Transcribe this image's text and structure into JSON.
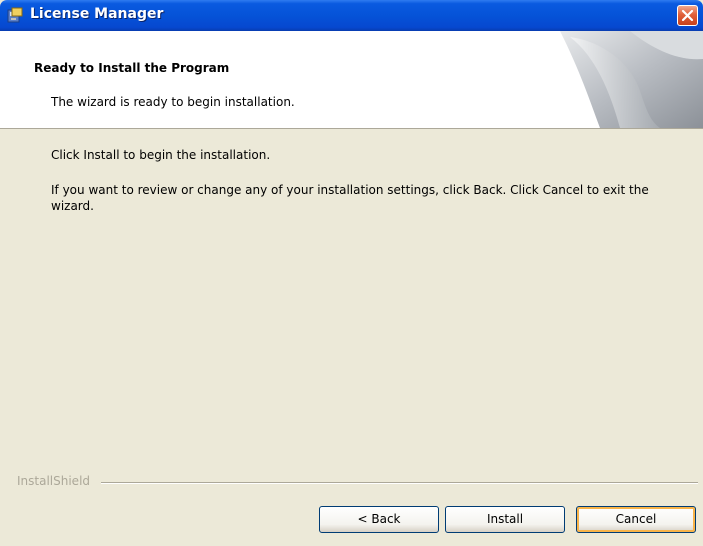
{
  "window": {
    "title": "License Manager",
    "icon": "installer-icon",
    "close_icon": "close-icon"
  },
  "header": {
    "title": "Ready to Install the Program",
    "subtitle": "The wizard is ready to begin installation."
  },
  "body": {
    "line1": "Click Install to begin the installation.",
    "line2": "If you want to review or change any of your installation settings, click Back. Click Cancel to exit the wizard."
  },
  "footer": {
    "brand": "InstallShield",
    "back_label": "< Back",
    "install_label": "Install",
    "cancel_label": "Cancel"
  },
  "colors": {
    "titlebar": "#0553d8",
    "close": "#e0603a",
    "dialog_bg": "#ece9d8",
    "default_focus": "#f8b44a"
  }
}
